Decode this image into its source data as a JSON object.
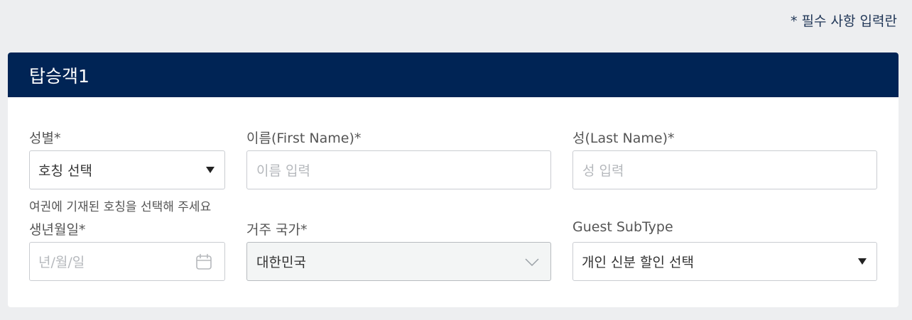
{
  "required_note": "* 필수 사항 입력란",
  "passenger": {
    "title": "탑승객1",
    "gender": {
      "label": "성별*",
      "selected": "호칭 선택",
      "hint": "여권에 기재된 호칭을 선택해 주세요"
    },
    "first_name": {
      "label": "이름(First Name)*",
      "placeholder": "이름 입력"
    },
    "last_name": {
      "label": "성(Last Name)*",
      "placeholder": "성 입력"
    },
    "birthdate": {
      "label": "생년월일*",
      "placeholder": "년/월/일",
      "icon": "calendar-icon"
    },
    "country": {
      "label": "거주 국가*",
      "selected": "대한민국",
      "icon": "chevron-down-icon"
    },
    "guest_subtype": {
      "label": "Guest SubType",
      "selected": "개인 신분 할인 선택"
    }
  }
}
